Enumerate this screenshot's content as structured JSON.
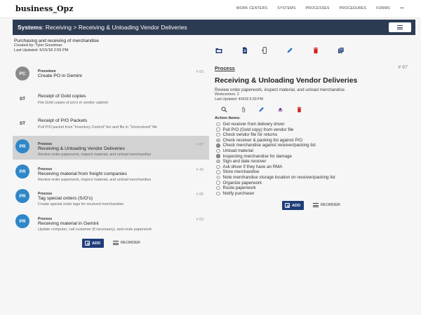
{
  "brand": "business_Opz",
  "nav": {
    "items": [
      "WORK CENTERS",
      "SYSTEMS",
      "PROCESSES",
      "PROCEDURES",
      "FORMS",
      "•••"
    ]
  },
  "header": {
    "section": "Systems",
    "breadcrumb": ": Receiving > Receiving & Unloading Vendor Deliveries"
  },
  "system_meta": {
    "description": "Purchasing and receiving of merchandise",
    "created_by": "Created by:  Tyler Goodman",
    "last_updated": "Last Updated:  5/15/18 2:55 PM"
  },
  "toolbar_icons": [
    "folder-icon",
    "document-icon",
    "mobile-icon",
    "edit-icon",
    "delete-icon",
    "copy-icon"
  ],
  "items": [
    {
      "avatar": "PC",
      "type": "Procedure",
      "title": "Create PO in Gemini",
      "description": "",
      "number": "# 83"
    },
    {
      "avatar": "ST",
      "type": "",
      "title": "Receipt of Gold copies",
      "description": "File Gold copies of p/o's in vendor cabinet",
      "number": ""
    },
    {
      "avatar": "ST",
      "type": "",
      "title": "Receipt of P/O Packets",
      "description": "Pull P/O packet from \"Inventory Control\" bin and file in \"Unreceived\" file",
      "number": ""
    },
    {
      "avatar": "PR",
      "type": "Process",
      "title": "Receiving & Unloading Vendor Deliveries",
      "description": "Review order paperwork, inspect material, and unload merchandise",
      "number": "# 87"
    },
    {
      "avatar": "PR",
      "type": "Process",
      "title": "Receiving material from freight companies",
      "description": "Review order paperwork, inspect material, and unload merchandise",
      "number": "# 40"
    },
    {
      "avatar": "PR",
      "type": "Process",
      "title": "Tag special orders (S/O's)",
      "description": "Create special order tags for received merchandise",
      "number": "# 88"
    },
    {
      "avatar": "PR",
      "type": "Process",
      "title": "Receiving material in Gemini",
      "description": "Update computer, call customer (if necessary), and route paperwork",
      "number": "# 69"
    }
  ],
  "list_actions": {
    "add_label": "ADD",
    "reorder_label": "REORDER"
  },
  "detail": {
    "kind": "Process",
    "number": "# 87",
    "title": "Receiving & Unloading Vendor Deliveries",
    "description": "Review order paperwork, inspect material, and unload merchandise",
    "workcenters": "Workcenters: 2",
    "last_updated": "Last Updated: 4/9/18 5:39 PM",
    "icons": [
      "search-icon",
      "attachment-icon",
      "edit-icon",
      "eject-icon",
      "delete-icon"
    ],
    "action_items_label": "Action Items:",
    "action_items": [
      {
        "label": "Get receiver from delivery driver",
        "state": "empty"
      },
      {
        "label": "Pull P/O (Gold copy) from vendor file",
        "state": "empty"
      },
      {
        "label": "Check vendor file for returns",
        "state": "empty"
      },
      {
        "label": "Check receiver & packing list against P/O",
        "state": "light"
      },
      {
        "label": "Check merchandise against receiver/packing list",
        "state": "dark"
      },
      {
        "label": "Unload material",
        "state": "empty"
      },
      {
        "label": "Inspecting merchandise for damage",
        "state": "dark"
      },
      {
        "label": "Sign and date receiver",
        "state": "light"
      },
      {
        "label": "Ask driver if they have an RMA",
        "state": "empty"
      },
      {
        "label": "Store merchandise",
        "state": "empty"
      },
      {
        "label": "Note merchandise storage location on receiver/packing list",
        "state": "pale"
      },
      {
        "label": "Organize paperwork",
        "state": "empty"
      },
      {
        "label": "Route paperwork",
        "state": "empty"
      },
      {
        "label": "Notify purchaser",
        "state": "empty"
      }
    ],
    "add_label": "ADD",
    "reorder_label": "REORDER"
  },
  "colors": {
    "header_bar": "#2d3b52",
    "process_avatar": "#2f87c8",
    "procedure_avatar": "#8a8a8a",
    "add_button": "#1f3c7a",
    "delete_icon": "#d32020",
    "toolbar_icon": "#1f3c7a",
    "edit_icon": "#1e6fd0"
  }
}
